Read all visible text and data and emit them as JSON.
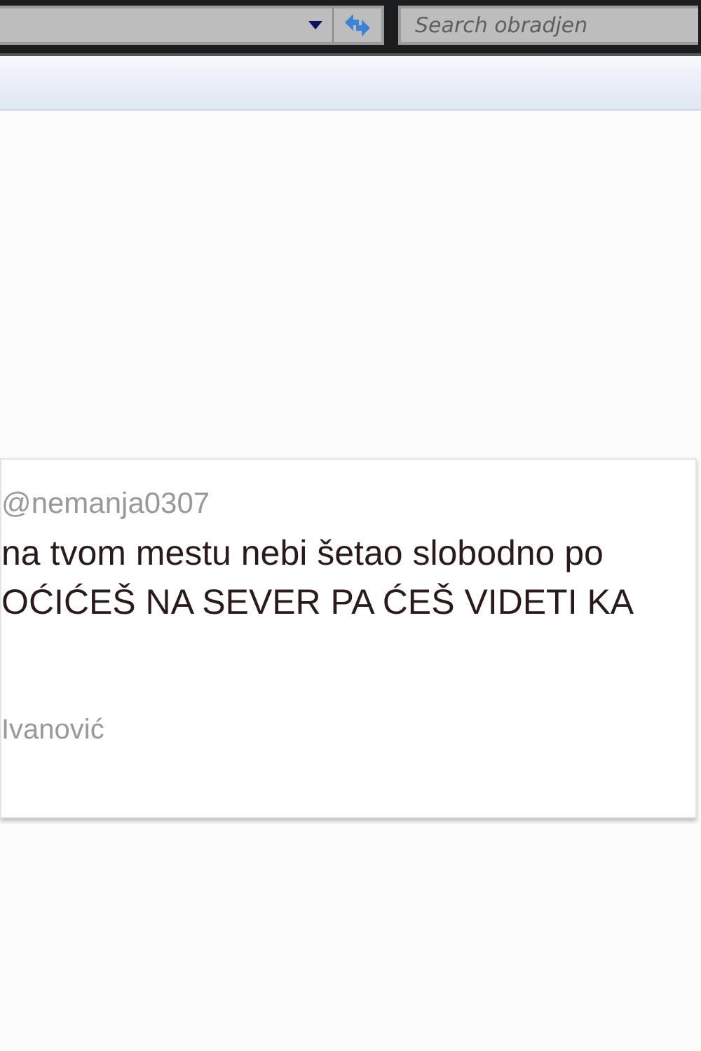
{
  "toolbar": {
    "search": {
      "placeholder": "Search obradjen"
    }
  },
  "tweet": {
    "handle": "@nemanja0307",
    "lines": [
      "na tvom mestu nebi šetao slobodno po",
      "OĆIĆEŠ NA SEVER PA ĆEŠ VIDETI KA"
    ],
    "author": "Ivanović"
  }
}
